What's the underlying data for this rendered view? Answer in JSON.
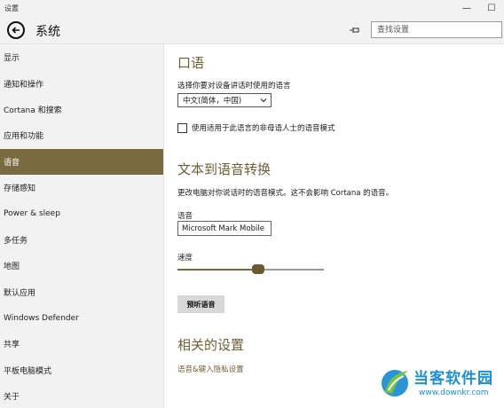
{
  "window": {
    "app_name": "设置",
    "minimize_glyph": "—",
    "maximize_glyph": "☐"
  },
  "header": {
    "title": "系统",
    "search_placeholder": "查找设置"
  },
  "sidebar": {
    "items": [
      {
        "label": "显示"
      },
      {
        "label": "通知和操作"
      },
      {
        "label": "Cortana 和搜索"
      },
      {
        "label": "应用和功能"
      },
      {
        "label": "语音",
        "active": true
      },
      {
        "label": "存储感知"
      },
      {
        "label": "Power & sleep"
      },
      {
        "label": "多任务"
      },
      {
        "label": "地图"
      },
      {
        "label": "默认应用"
      },
      {
        "label": "Windows Defender"
      },
      {
        "label": "共享"
      },
      {
        "label": "平板电脑模式"
      },
      {
        "label": "关于"
      }
    ]
  },
  "speech": {
    "heading": "口语",
    "language_prompt": "选择你要对设备讲话时使用的语言",
    "language_value": "中文(简体，中国)",
    "nonnative_checkbox_label": "使用适用于此语言的非母语人士的语音模式",
    "nonnative_checked": false
  },
  "tts": {
    "heading": "文本到语音转换",
    "description": "更改电脑对你说话时的语音模式。这不会影响 Cortana 的语音。",
    "voice_label": "语音",
    "voice_value": "Microsoft Mark Mobile",
    "speed_label": "速度",
    "speed_fraction": 0.55,
    "preview_button": "预听语音"
  },
  "related": {
    "heading": "相关的设置",
    "link": "语音&键入隐私设置"
  },
  "watermark": {
    "logo_text": "当客软件园",
    "logo_url": "www.downkr.com"
  },
  "colors": {
    "accent": "#7a6a3f",
    "heading": "#6e5e36",
    "logo": "#1e8fd0"
  }
}
